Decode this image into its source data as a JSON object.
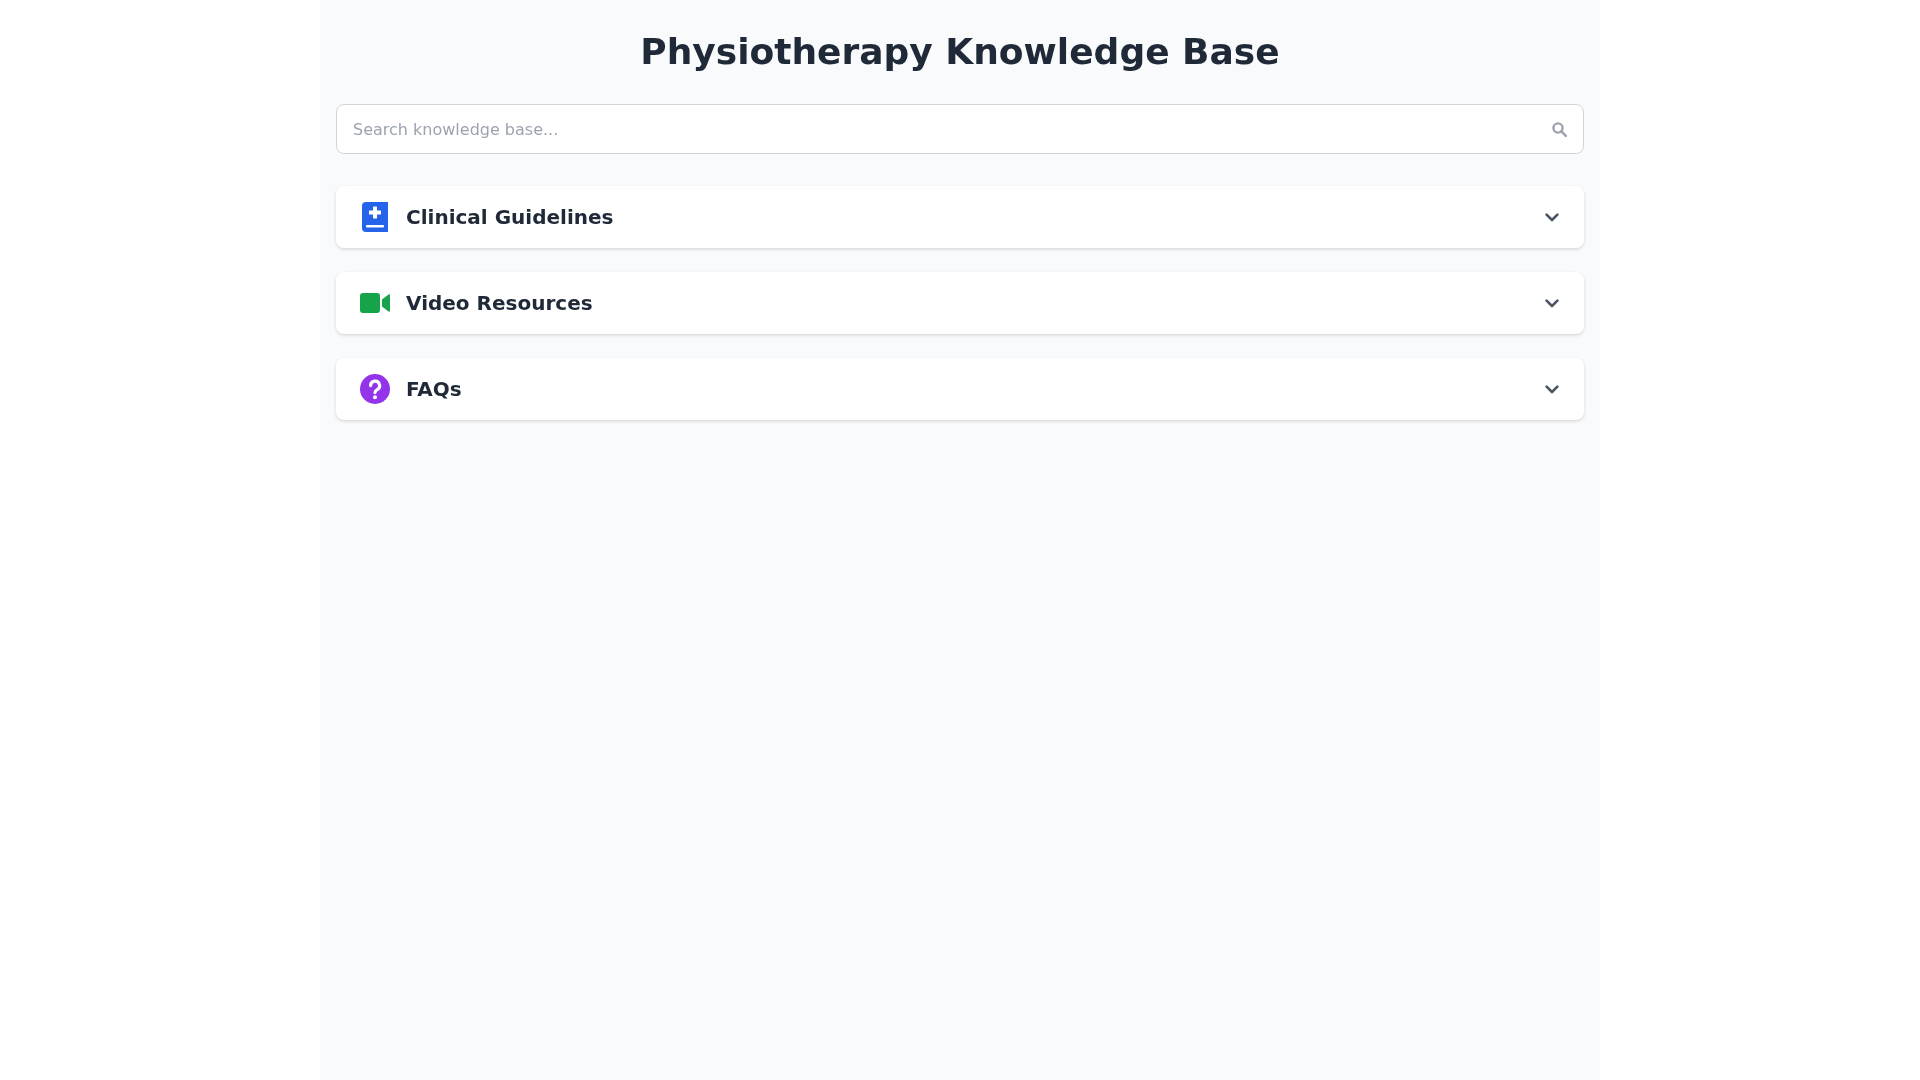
{
  "title": "Physiotherapy Knowledge Base",
  "search": {
    "placeholder": "Search knowledge base..."
  },
  "sections": [
    {
      "kind": "guidelines",
      "title": "Clinical Guidelines",
      "color": "#2563eb",
      "expanded": false
    },
    {
      "kind": "videos",
      "title": "Video Resources",
      "color": "#16a34a",
      "expanded": false
    },
    {
      "kind": "faq",
      "title": "FAQs",
      "color": "#9333ea",
      "expanded": false
    }
  ]
}
